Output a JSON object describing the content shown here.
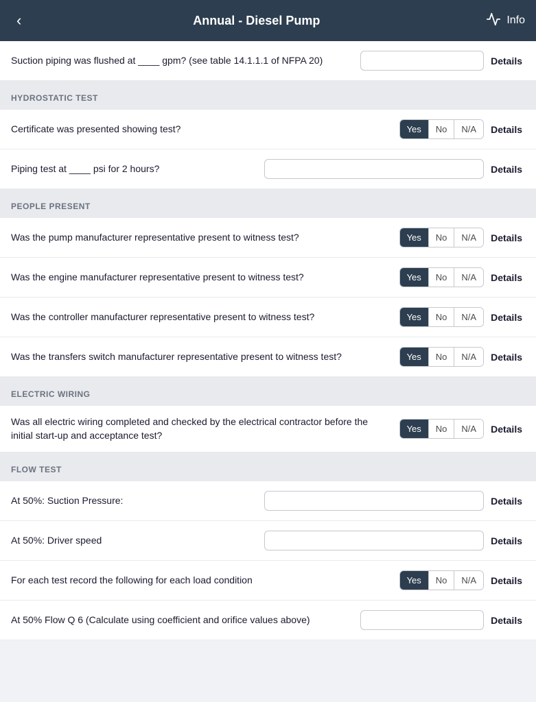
{
  "header": {
    "back_label": "‹",
    "title": "Annual - Diesel Pump",
    "info_label": "Info",
    "info_icon": "〜"
  },
  "sections": [
    {
      "id": "top",
      "label": null,
      "questions": [
        {
          "id": "q1",
          "text": "Suction piping was flushed at ____ gpm? (see table 14.1.1.1 of NFPA 20)",
          "type": "input",
          "input_size": "medium",
          "details_label": "Details"
        }
      ]
    },
    {
      "id": "hydrostatic",
      "label": "HYDROSTATIC TEST",
      "questions": [
        {
          "id": "q2",
          "text": "Certificate was presented showing test?",
          "type": "yes-no-na",
          "selected": "yes",
          "yes_label": "Yes",
          "no_label": "No",
          "na_label": "N/A",
          "details_label": "Details"
        },
        {
          "id": "q3",
          "text": "Piping test at ____ psi for 2 hours?",
          "type": "input",
          "input_size": "large",
          "details_label": "Details"
        }
      ]
    },
    {
      "id": "people",
      "label": "PEOPLE PRESENT",
      "questions": [
        {
          "id": "q4",
          "text": "Was the pump manufacturer representative present to witness test?",
          "type": "yes-no-na",
          "selected": "yes",
          "yes_label": "Yes",
          "no_label": "No",
          "na_label": "N/A",
          "details_label": "Details"
        },
        {
          "id": "q5",
          "text": "Was the engine manufacturer representative present to witness test?",
          "type": "yes-no-na",
          "selected": "yes",
          "yes_label": "Yes",
          "no_label": "No",
          "na_label": "N/A",
          "details_label": "Details"
        },
        {
          "id": "q6",
          "text": "Was the controller manufacturer representative present to witness test?",
          "type": "yes-no-na",
          "selected": "yes",
          "yes_label": "Yes",
          "no_label": "No",
          "na_label": "N/A",
          "details_label": "Details"
        },
        {
          "id": "q7",
          "text": "Was the transfers switch manufacturer representative present to witness test?",
          "type": "yes-no-na",
          "selected": "yes",
          "yes_label": "Yes",
          "no_label": "No",
          "na_label": "N/A",
          "details_label": "Details"
        }
      ]
    },
    {
      "id": "electric",
      "label": "ELECTRIC WIRING",
      "questions": [
        {
          "id": "q8",
          "text": "Was all electric wiring completed and checked by the electrical contractor before the initial start-up and acceptance test?",
          "type": "yes-no-na",
          "selected": "yes",
          "yes_label": "Yes",
          "no_label": "No",
          "na_label": "N/A",
          "details_label": "Details"
        }
      ]
    },
    {
      "id": "flow",
      "label": "FLOW TEST",
      "questions": [
        {
          "id": "q9",
          "text": "At 50%: Suction Pressure:",
          "type": "input",
          "input_size": "large",
          "details_label": "Details"
        },
        {
          "id": "q10",
          "text": "At 50%: Driver speed",
          "type": "input",
          "input_size": "large",
          "details_label": "Details"
        },
        {
          "id": "q11",
          "text": "For each test record the following for each load condition",
          "type": "yes-no-na",
          "selected": "yes",
          "yes_label": "Yes",
          "no_label": "No",
          "na_label": "N/A",
          "details_label": "Details"
        },
        {
          "id": "q12",
          "text": "At 50% Flow Q 6 (Calculate using coefficient and orifice values above)",
          "type": "input",
          "input_size": "medium",
          "details_label": "Details"
        }
      ]
    }
  ]
}
